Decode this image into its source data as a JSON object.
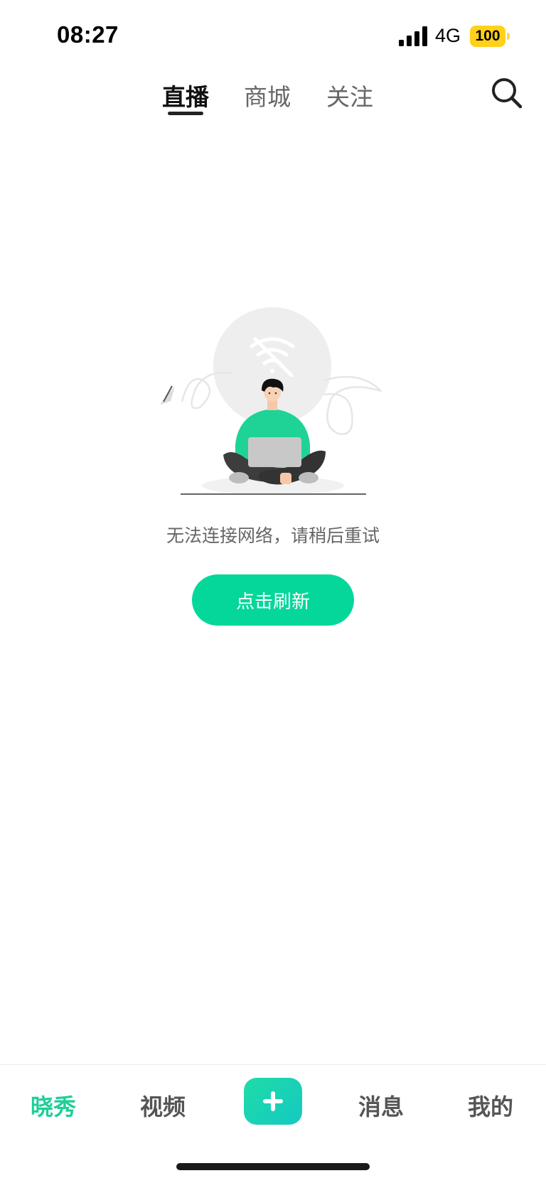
{
  "status_bar": {
    "time": "08:27",
    "network": "4G",
    "battery": "100"
  },
  "top_tabs": {
    "items": [
      {
        "label": "直播",
        "active": true
      },
      {
        "label": "商城",
        "active": false
      },
      {
        "label": "关注",
        "active": false
      }
    ],
    "search_icon": "search-icon"
  },
  "empty_state": {
    "illustration_icon": "wifi-off-icon",
    "message": "无法连接网络，请稍后重试",
    "refresh_label": "点击刷新"
  },
  "bottom_nav": {
    "items": [
      {
        "label": "晓秀",
        "active": true
      },
      {
        "label": "视频",
        "active": false
      },
      {
        "label": "消息",
        "active": false
      },
      {
        "label": "我的",
        "active": false
      }
    ],
    "add_icon": "plus-icon"
  },
  "colors": {
    "accent": "#05d79a",
    "active_nav": "#1ecf98",
    "battery": "#ffd11a"
  }
}
